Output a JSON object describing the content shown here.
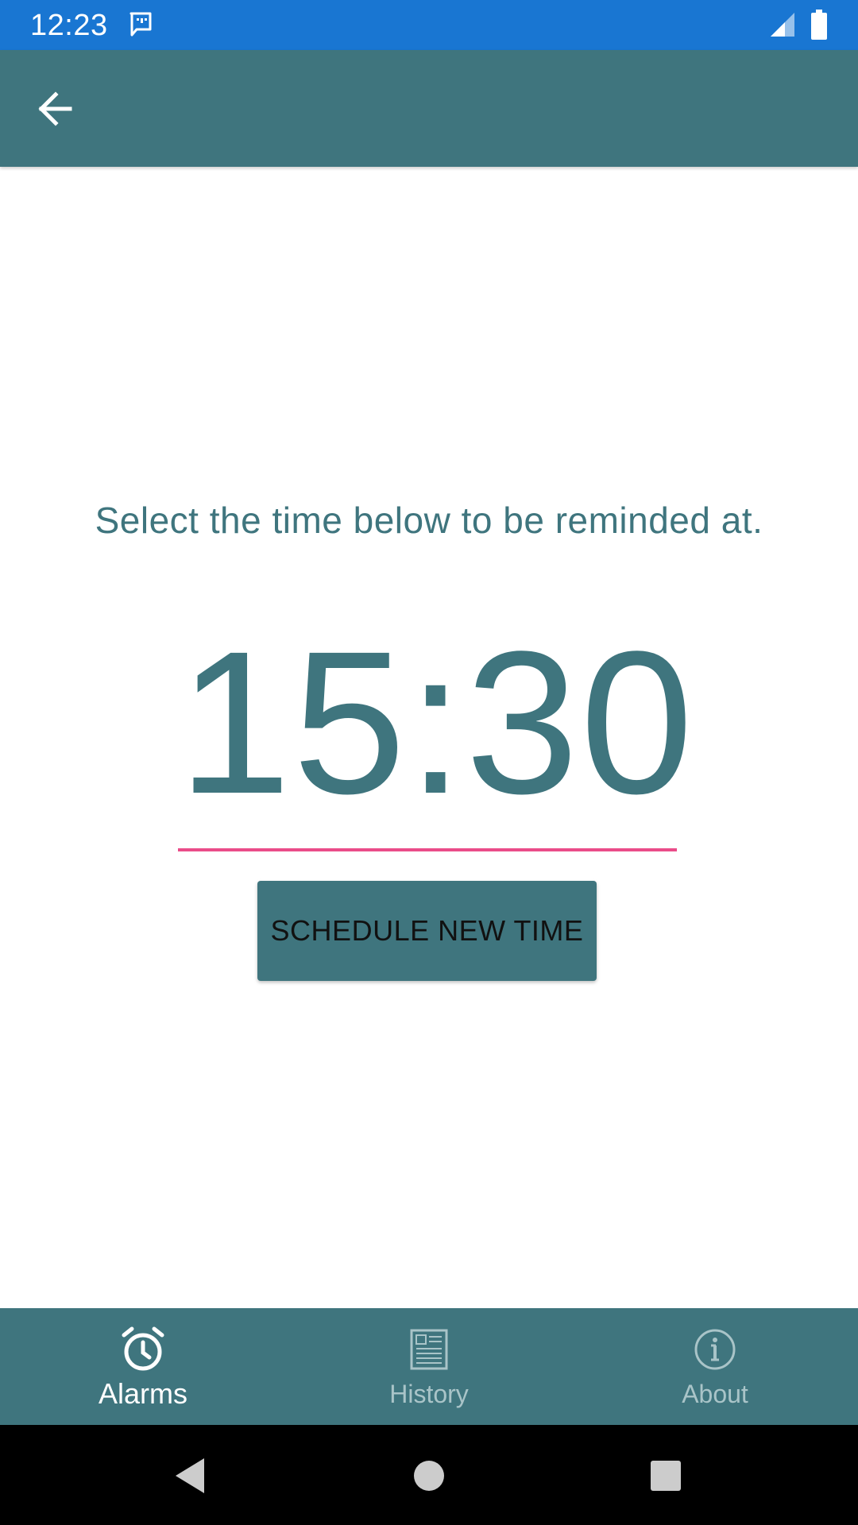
{
  "status_bar": {
    "time": "12:23",
    "color": "#1976d2",
    "icons": [
      "message-icon",
      "signal-icon",
      "battery-icon"
    ]
  },
  "app_bar": {
    "color": "#3f757e",
    "back_icon": "arrow-back-icon"
  },
  "main": {
    "prompt": "Select the time below to be reminded at.",
    "time_value": "15:30",
    "underline_color": "#ea4c89",
    "schedule_button_label": "SCHEDULE NEW TIME"
  },
  "bottom_nav": {
    "items": [
      {
        "label": "Alarms",
        "icon": "alarm-clock-icon",
        "active": true
      },
      {
        "label": "History",
        "icon": "history-icon",
        "active": false
      },
      {
        "label": "About",
        "icon": "info-icon",
        "active": false
      }
    ]
  },
  "system_nav": {
    "buttons": [
      "back-triangle-icon",
      "home-circle-icon",
      "recents-square-icon"
    ]
  }
}
